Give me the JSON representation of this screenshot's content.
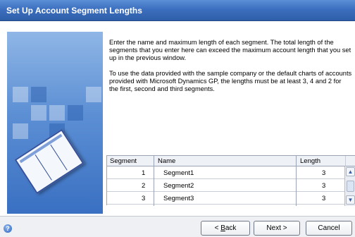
{
  "window": {
    "title": "Set Up Account Segment Lengths"
  },
  "description": {
    "paragraph1": "Enter the name and maximum length of each segment. The total length of the segments that you enter here can exceed the maximum account length that you set up in the previous window.",
    "paragraph2": "To use the data provided with the sample company or the default charts of accounts provided with Microsoft Dynamics GP, the lengths must be at least 3, 4 and 2 for the first, second and third segments."
  },
  "grid": {
    "columns": [
      "Segment",
      "Name",
      "Length"
    ],
    "rows": [
      {
        "segment": "1",
        "name": "Segment1",
        "length": "3"
      },
      {
        "segment": "2",
        "name": "Segment2",
        "length": "3"
      },
      {
        "segment": "3",
        "name": "Segment3",
        "length": "3"
      }
    ]
  },
  "buttons": {
    "back": {
      "arrow": "< ",
      "mnemonic": "B",
      "rest": "ack"
    },
    "next": "Next >",
    "cancel": "Cancel"
  },
  "icons": {
    "help": "help-icon",
    "scroll_up": "chevron-up-icon",
    "scroll_down": "chevron-down-icon"
  },
  "colors": {
    "title_bar": "#3c6fbf",
    "side_art": "#5c8fd4"
  }
}
